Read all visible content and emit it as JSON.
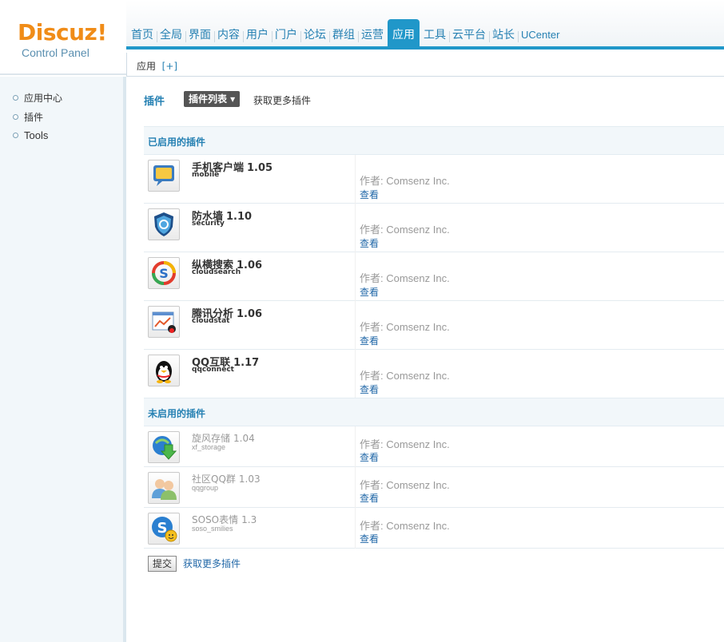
{
  "logo": {
    "brand": "Discuz!",
    "subtitle": "Control Panel"
  },
  "nav": {
    "items": [
      "首页",
      "全局",
      "界面",
      "内容",
      "用户",
      "门户",
      "论坛",
      "群组",
      "运营",
      "应用",
      "工具",
      "云平台",
      "站长",
      "UCenter"
    ],
    "active": "应用"
  },
  "subnav": {
    "label": "应用",
    "add": "[+]"
  },
  "sidebar": {
    "items": [
      "应用中心",
      "插件",
      "Tools"
    ]
  },
  "main": {
    "title": "插件",
    "list_button": "插件列表 ▾",
    "more_top": "获取更多插件",
    "enabled_header": "已启用的插件",
    "disabled_header": "未启用的插件",
    "submit": "提交",
    "more_bottom": "获取更多插件"
  },
  "enabled_plugins": [
    {
      "name": "手机客户端",
      "version": "1.05",
      "id": "mobile",
      "author": "作者: Comsenz Inc.",
      "view": "查看",
      "icon": "mobile-chat-icon"
    },
    {
      "name": "防水墙",
      "version": "1.10",
      "id": "security",
      "author": "作者: Comsenz Inc.",
      "view": "查看",
      "icon": "security-shield-icon"
    },
    {
      "name": "纵横搜索",
      "version": "1.06",
      "id": "cloudsearch",
      "author": "作者: Comsenz Inc.",
      "view": "查看",
      "icon": "cloudsearch-icon"
    },
    {
      "name": "腾讯分析",
      "version": "1.06",
      "id": "cloudstat",
      "author": "作者: Comsenz Inc.",
      "view": "查看",
      "icon": "cloudstat-chart-icon"
    },
    {
      "name": "QQ互联",
      "version": "1.17",
      "id": "qqconnect",
      "author": "作者: Comsenz Inc.",
      "view": "查看",
      "icon": "qq-penguin-icon"
    }
  ],
  "disabled_plugins": [
    {
      "name": "旋风存储",
      "version": "1.04",
      "id": "xf_storage",
      "author": "作者: Comsenz Inc.",
      "view": "查看",
      "icon": "storage-download-icon"
    },
    {
      "name": "社区QQ群",
      "version": "1.03",
      "id": "qqgroup",
      "author": "作者: Comsenz Inc.",
      "view": "查看",
      "icon": "qq-group-icon"
    },
    {
      "name": "SOSO表情",
      "version": "1.3",
      "id": "soso_smilies",
      "author": "作者: Comsenz Inc.",
      "view": "查看",
      "icon": "soso-smiley-icon"
    }
  ]
}
